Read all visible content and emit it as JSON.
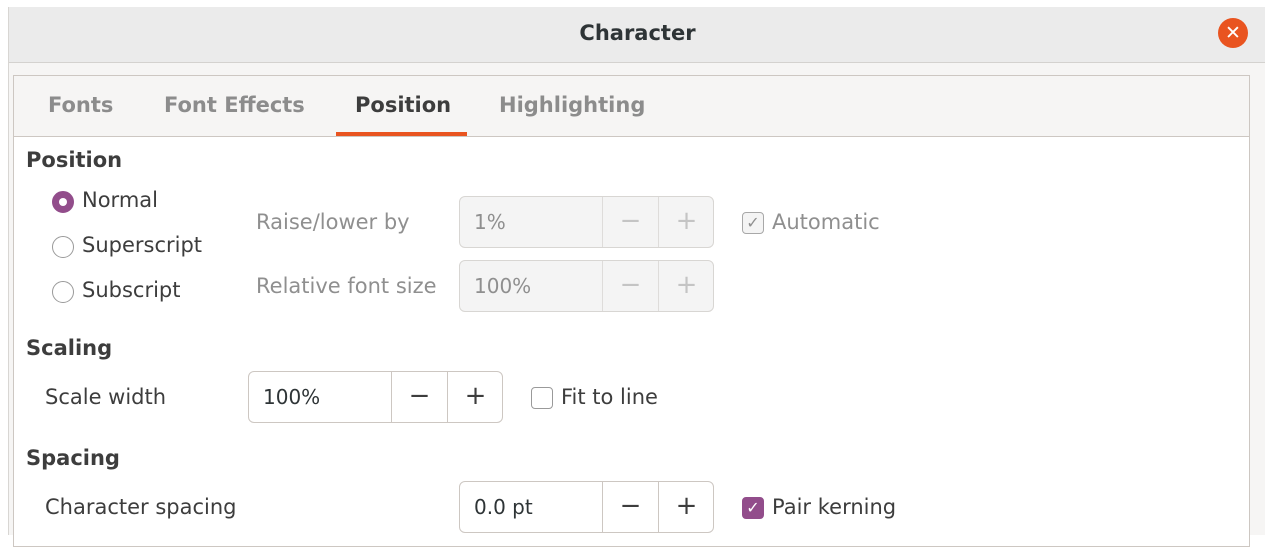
{
  "window": {
    "title": "Character"
  },
  "tabs": [
    {
      "label": "Fonts"
    },
    {
      "label": "Font Effects"
    },
    {
      "label": "Position",
      "active": true
    },
    {
      "label": "Highlighting"
    }
  ],
  "position": {
    "title": "Position",
    "options": [
      {
        "label": "Normal",
        "checked": true
      },
      {
        "label": "Superscript",
        "checked": false
      },
      {
        "label": "Subscript",
        "checked": false
      }
    ],
    "raise_lower_label": "Raise/lower by",
    "raise_lower_value": "1%",
    "relative_size_label": "Relative font size",
    "relative_size_value": "100%",
    "automatic_label": "Automatic",
    "automatic_checked": true
  },
  "scaling": {
    "title": "Scaling",
    "scale_width_label": "Scale width",
    "scale_width_value": "100%",
    "fit_to_line_label": "Fit to line",
    "fit_to_line_checked": false
  },
  "spacing": {
    "title": "Spacing",
    "character_spacing_label": "Character spacing",
    "character_spacing_value": "0.0 pt",
    "pair_kerning_label": "Pair kerning",
    "pair_kerning_checked": true
  },
  "glyphs": {
    "minus": "−",
    "plus": "+",
    "check": "✓",
    "close": "✕"
  },
  "colors": {
    "accent": "#e95420",
    "checked": "#924d8b"
  }
}
